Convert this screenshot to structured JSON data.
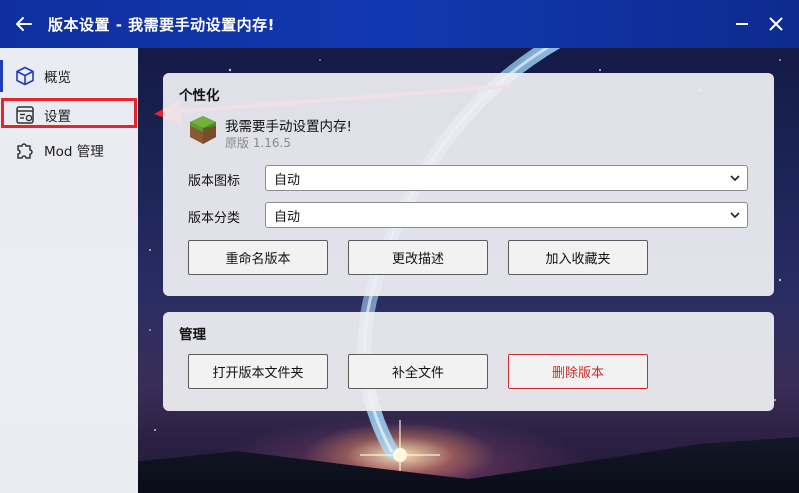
{
  "window": {
    "title": "版本设置 - 我需要手动设置内存!",
    "accent_color": "#1238b0"
  },
  "sidebar": {
    "items": [
      {
        "label": "概览",
        "icon": "cube-icon"
      },
      {
        "label": "设置",
        "icon": "settings-doc-icon"
      },
      {
        "label": "Mod 管理",
        "icon": "puzzle-icon"
      }
    ],
    "highlight_color": "#e8242b"
  },
  "personalize": {
    "title": "个性化",
    "version_name": "我需要手动设置内存!",
    "version_sub": "原版 1.16.5",
    "icon_label": "版本图标",
    "icon_value": "自动",
    "category_label": "版本分类",
    "category_value": "自动",
    "rename_button": "重命名版本",
    "edit_desc_button": "更改描述",
    "favorite_button": "加入收藏夹"
  },
  "manage": {
    "title": "管理",
    "open_folder_button": "打开版本文件夹",
    "complete_files_button": "补全文件",
    "delete_button": "删除版本",
    "danger_color": "#d02a2a"
  }
}
